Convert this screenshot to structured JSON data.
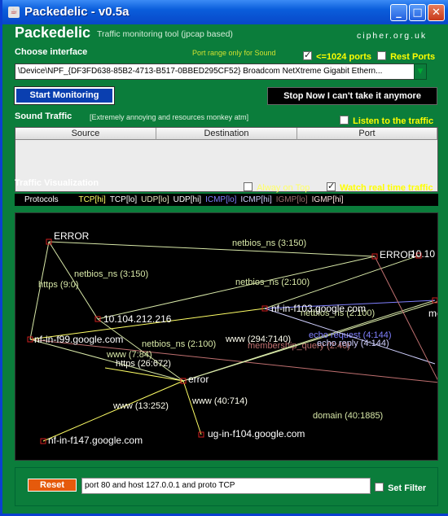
{
  "window": {
    "title": "Packedelic - v0.5a",
    "icon_name": "java-cup-icon"
  },
  "header": {
    "app_name": "Packedelic",
    "subtitle": "Traffic monitoring tool (jpcap based)",
    "brand": "cipher.org.uk"
  },
  "interface": {
    "label": "Choose interface",
    "port_note": "Port range only for Sound",
    "ports_1024_label": "<=1024 ports",
    "ports_1024_checked": true,
    "rest_ports_label": "Rest Ports",
    "rest_ports_checked": false,
    "selected": "\\Device\\NPF_{DF3FD638-85B2-4713-B517-0BBED295CF52}  Broadcom NetXtreme Gigabit Ethern..."
  },
  "buttons": {
    "start": "Start Monitoring",
    "stop": "Stop Now I can't take it anymore"
  },
  "sound": {
    "label": "Sound Traffic",
    "note": "[Extremely annoying and resources monkey atm]",
    "listen_label": "Listen to the traffic",
    "listen_checked": false
  },
  "table": {
    "columns": [
      "Source",
      "Destination",
      "Port"
    ]
  },
  "visualization": {
    "label": "Traffic Visualization",
    "always_on_top_label": "Alway on Top",
    "always_on_top_checked": false,
    "watch_label": "Watch real time traffic",
    "watch_checked": true
  },
  "protocols": {
    "label": "Protocols",
    "items": [
      {
        "text": "TCP[hi]",
        "color": "#ffff66"
      },
      {
        "text": "TCP[lo]",
        "color": "#ffffff"
      },
      {
        "text": "UDP[lo]",
        "color": "#e8e8c0"
      },
      {
        "text": "UDP[hi]",
        "color": "#ffffff"
      },
      {
        "text": "ICMP[lo]",
        "color": "#8080ff"
      },
      {
        "text": "ICMP[hi]",
        "color": "#d0d0ff"
      },
      {
        "text": "IGMP[lo]",
        "color": "#a07070"
      },
      {
        "text": "IGMP[hi]",
        "color": "#ffe0e0"
      }
    ]
  },
  "graph": {
    "nodes": [
      {
        "id": "error1",
        "label": "ERROR"
      },
      {
        "id": "error2",
        "label": "ERROR"
      },
      {
        "id": "n10",
        "label": "10.104.212.216"
      },
      {
        "id": "f103",
        "label": "nf-in-f103.google.com"
      },
      {
        "id": "f99",
        "label": "nf-in-f99.google.com"
      },
      {
        "id": "err3",
        "label": "error"
      },
      {
        "id": "f147",
        "label": "nf-in-f147.google.com"
      },
      {
        "id": "f104",
        "label": "ug-in-f104.google.com"
      },
      {
        "id": "edge_me",
        "label": "me"
      },
      {
        "id": "edge_ab",
        "label": "10.10"
      }
    ],
    "edges": [
      {
        "from": "error1",
        "to": "error2",
        "label": "netbios_ns (3:150)",
        "color": "#d8e8a8"
      },
      {
        "from": "error1",
        "to": "n10",
        "label": "netbios_ns (3:150)",
        "color": "#d8e8a8"
      },
      {
        "from": "error1",
        "to": "f99",
        "label": "https (9:0)",
        "color": "#d8e8a8"
      },
      {
        "from": "n10",
        "to": "error2",
        "label": "netbios_ns (2:100)",
        "color": "#d8e8a8"
      },
      {
        "from": "f103",
        "to": "edge_ab",
        "label": "netbios_ns (2:100)",
        "color": "#d8e8a8"
      },
      {
        "from": "n10",
        "to": "err3",
        "label": "",
        "color": "#d8e8a8"
      },
      {
        "from": "f99",
        "to": "f103",
        "label": "www (294:7140)",
        "color": "#ffff66"
      },
      {
        "from": "f99",
        "to": "edge_r",
        "label": "membership_query (2:40)",
        "color": "#c07070"
      },
      {
        "from": "err3",
        "to": "edge_me",
        "label": "netbios_ns (2:100)",
        "color": "#d8e8a8"
      },
      {
        "from": "err3",
        "to": "f99",
        "label": "www (7:84)",
        "color": "#d8e8a8"
      },
      {
        "from": "err3",
        "to": "f99b",
        "label": "https (26:672)",
        "color": "#ffff66"
      },
      {
        "from": "err3",
        "to": "f147",
        "label": "www (13:252)",
        "color": "#ffff66"
      },
      {
        "from": "err3",
        "to": "f104",
        "label": "www (40:714)",
        "color": "#ffff66"
      },
      {
        "from": "err3",
        "to": "edge_r2",
        "label": "domain (40:1885)",
        "color": "#d8e8a8"
      },
      {
        "from": "f103",
        "to": "edge_me",
        "label": "echo request (4:144)",
        "color": "#8080ff"
      },
      {
        "from": "f103",
        "to": "edge_me2",
        "label": "echo reply (4:144)",
        "color": "#d0d0ff"
      },
      {
        "from": "error2",
        "to": "edge_r3",
        "label": "",
        "color": "#c07070"
      }
    ]
  },
  "filter": {
    "reset_label": "Reset",
    "value": "port 80 and host 127.0.0.1 and proto TCP",
    "set_filter_label": "Set Filter",
    "set_filter_checked": false
  }
}
